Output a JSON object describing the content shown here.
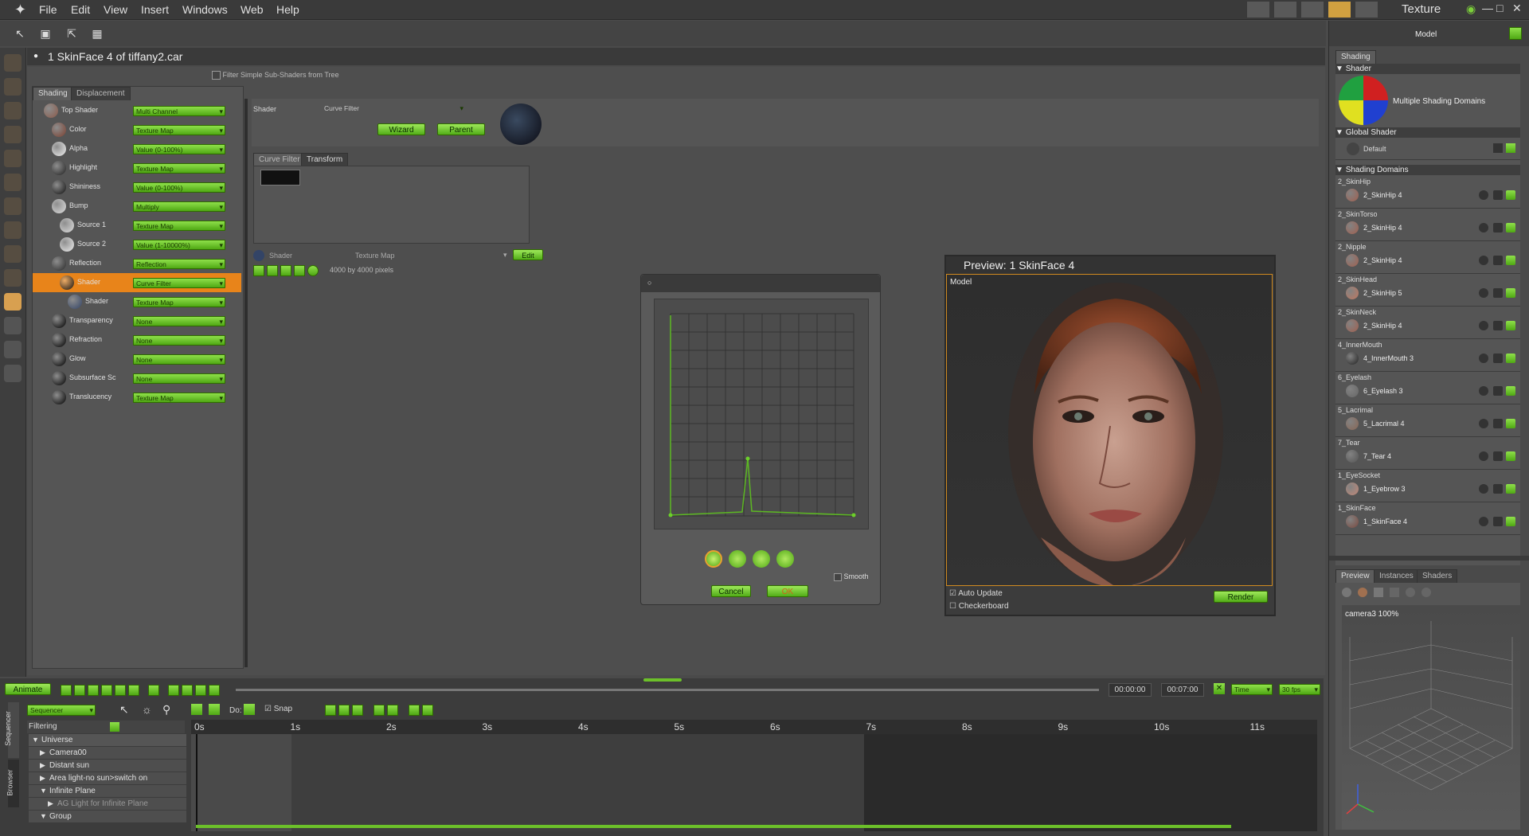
{
  "menu": {
    "items": [
      "File",
      "Edit",
      "View",
      "Insert",
      "Windows",
      "Web",
      "Help"
    ],
    "room_title": "Texture"
  },
  "document": {
    "title": "1  SkinFace 4 of tiffany2.car"
  },
  "left_panel": {
    "filter_label": "Filter Simple Sub-Shaders from Tree",
    "tabs": [
      "Shading",
      "Displacement"
    ],
    "tree": [
      {
        "label": "Top Shader",
        "value": "Multi Channel",
        "indent": 0,
        "color": "#8a5a4a"
      },
      {
        "label": "Color",
        "value": "Texture Map",
        "indent": 1,
        "color": "#7a4030"
      },
      {
        "label": "Alpha",
        "value": "Value (0-100%)",
        "indent": 1,
        "color": "#eeeeee"
      },
      {
        "label": "Highlight",
        "value": "Texture Map",
        "indent": 1,
        "color": "#222222"
      },
      {
        "label": "Shininess",
        "value": "Value (0-100%)",
        "indent": 1,
        "color": "#111111"
      },
      {
        "label": "Bump",
        "value": "Multiply",
        "indent": 1,
        "color": "#dddddd"
      },
      {
        "label": "Source 1",
        "value": "Texture Map",
        "indent": 2,
        "color": "#dddddd"
      },
      {
        "label": "Source 2",
        "value": "Value (1-10000%)",
        "indent": 2,
        "color": "#eeeeee"
      },
      {
        "label": "Reflection",
        "value": "Reflection",
        "indent": 1,
        "color": "#2a2a2a"
      },
      {
        "label": "Shader",
        "value": "Curve Filter",
        "indent": 2,
        "color": "#111111"
      },
      {
        "label": "Shader",
        "value": "Texture Map",
        "indent": 3,
        "color": "#334466"
      },
      {
        "label": "Transparency",
        "value": "None",
        "indent": 1,
        "color": "#000000"
      },
      {
        "label": "Refraction",
        "value": "None",
        "indent": 1,
        "color": "#000000"
      },
      {
        "label": "Glow",
        "value": "None",
        "indent": 1,
        "color": "#000000"
      },
      {
        "label": "Subsurface Sc",
        "value": "None",
        "indent": 1,
        "color": "#000000"
      },
      {
        "label": "Translucency",
        "value": "Texture Map",
        "indent": 1,
        "color": "#000000"
      }
    ]
  },
  "editor": {
    "shader_label": "Shader",
    "shader_value": "Curve Filter",
    "wizard_label": "Wizard",
    "parent_label": "Parent",
    "tabs": [
      "Curve Filter",
      "Transform"
    ],
    "sub_shader_label": "Shader",
    "sub_shader_value": "Texture Map",
    "edit_label": "Edit",
    "pixels_label": "4000 by 4000 pixels"
  },
  "curve_dialog": {
    "smooth_label": "Smooth",
    "cancel_label": "Cancel",
    "ok_label": "OK"
  },
  "preview": {
    "title": "Preview: 1  SkinFace 4",
    "model_label": "Model",
    "auto_update_label": "Auto Update",
    "checkerboard_label": "Checkerboard",
    "render_label": "Render"
  },
  "right_panel": {
    "header": "Model",
    "tab": "Shading",
    "shader_section": "Shader",
    "multi_domains_label": "Multiple Shading Domains",
    "global_shader_section": "Global Shader",
    "global_default": "Default",
    "domains_section": "Shading Domains",
    "domains": [
      {
        "domain": "2_SkinHip",
        "shader": "2_SkinHip 4",
        "color": "#a06050"
      },
      {
        "domain": "2_SkinTorso",
        "shader": "2_SkinHip 4",
        "color": "#a06050"
      },
      {
        "domain": "2_Nipple",
        "shader": "2_SkinHip 4",
        "color": "#a06050"
      },
      {
        "domain": "2_SkinHead",
        "shader": "2_SkinHip 5",
        "color": "#c07860"
      },
      {
        "domain": "2_SkinNeck",
        "shader": "2_SkinHip 4",
        "color": "#a06050"
      },
      {
        "domain": "4_InnerMouth",
        "shader": "4_InnerMouth 3",
        "color": "#222222"
      },
      {
        "domain": "6_Eyelash",
        "shader": "6_Eyelash 3",
        "color": "#666666"
      },
      {
        "domain": "5_Lacrimal",
        "shader": "5_Lacrimal 4",
        "color": "#886655"
      },
      {
        "domain": "7_Tear",
        "shader": "7_Tear 4",
        "color": "#555555"
      },
      {
        "domain": "1_EyeSocket",
        "shader": "1_Eyebrow 3",
        "color": "#c08878"
      },
      {
        "domain": "1_SkinFace",
        "shader": "1_SkinFace 4",
        "color": "#7a4a40"
      }
    ],
    "bottom_tabs": [
      "Preview",
      "Instances",
      "Shaders"
    ],
    "camera_label": "camera3 100%"
  },
  "timeline": {
    "animate_label": "Animate",
    "time_start": "00:00:00",
    "time_end": "00:07:00",
    "time_mode": "Time",
    "fps": "30 fps",
    "sequencer": "Sequencer",
    "do_label": "Do:",
    "snap_label": "Snap",
    "filtering_label": "Filtering",
    "side_tabs": [
      "Sequencer",
      "Browser"
    ],
    "ticks": [
      "0s",
      "1s",
      "2s",
      "3s",
      "4s",
      "5s",
      "6s",
      "7s",
      "8s",
      "9s",
      "10s",
      "11s"
    ],
    "tracks": [
      {
        "label": "Universe",
        "level": 0,
        "open": true
      },
      {
        "label": "Camera00",
        "level": 1,
        "open": false
      },
      {
        "label": "Distant sun",
        "level": 1,
        "open": false
      },
      {
        "label": "Area light-no sun>switch on",
        "level": 1,
        "open": false
      },
      {
        "label": "Infinite Plane",
        "level": 1,
        "open": true
      },
      {
        "label": "AG Light for Infinite Plane",
        "level": 2,
        "open": false
      },
      {
        "label": "Group",
        "level": 1,
        "open": true
      }
    ]
  },
  "colors": {
    "accent_green": "#6cc02a",
    "selection_orange": "#e8841a"
  }
}
